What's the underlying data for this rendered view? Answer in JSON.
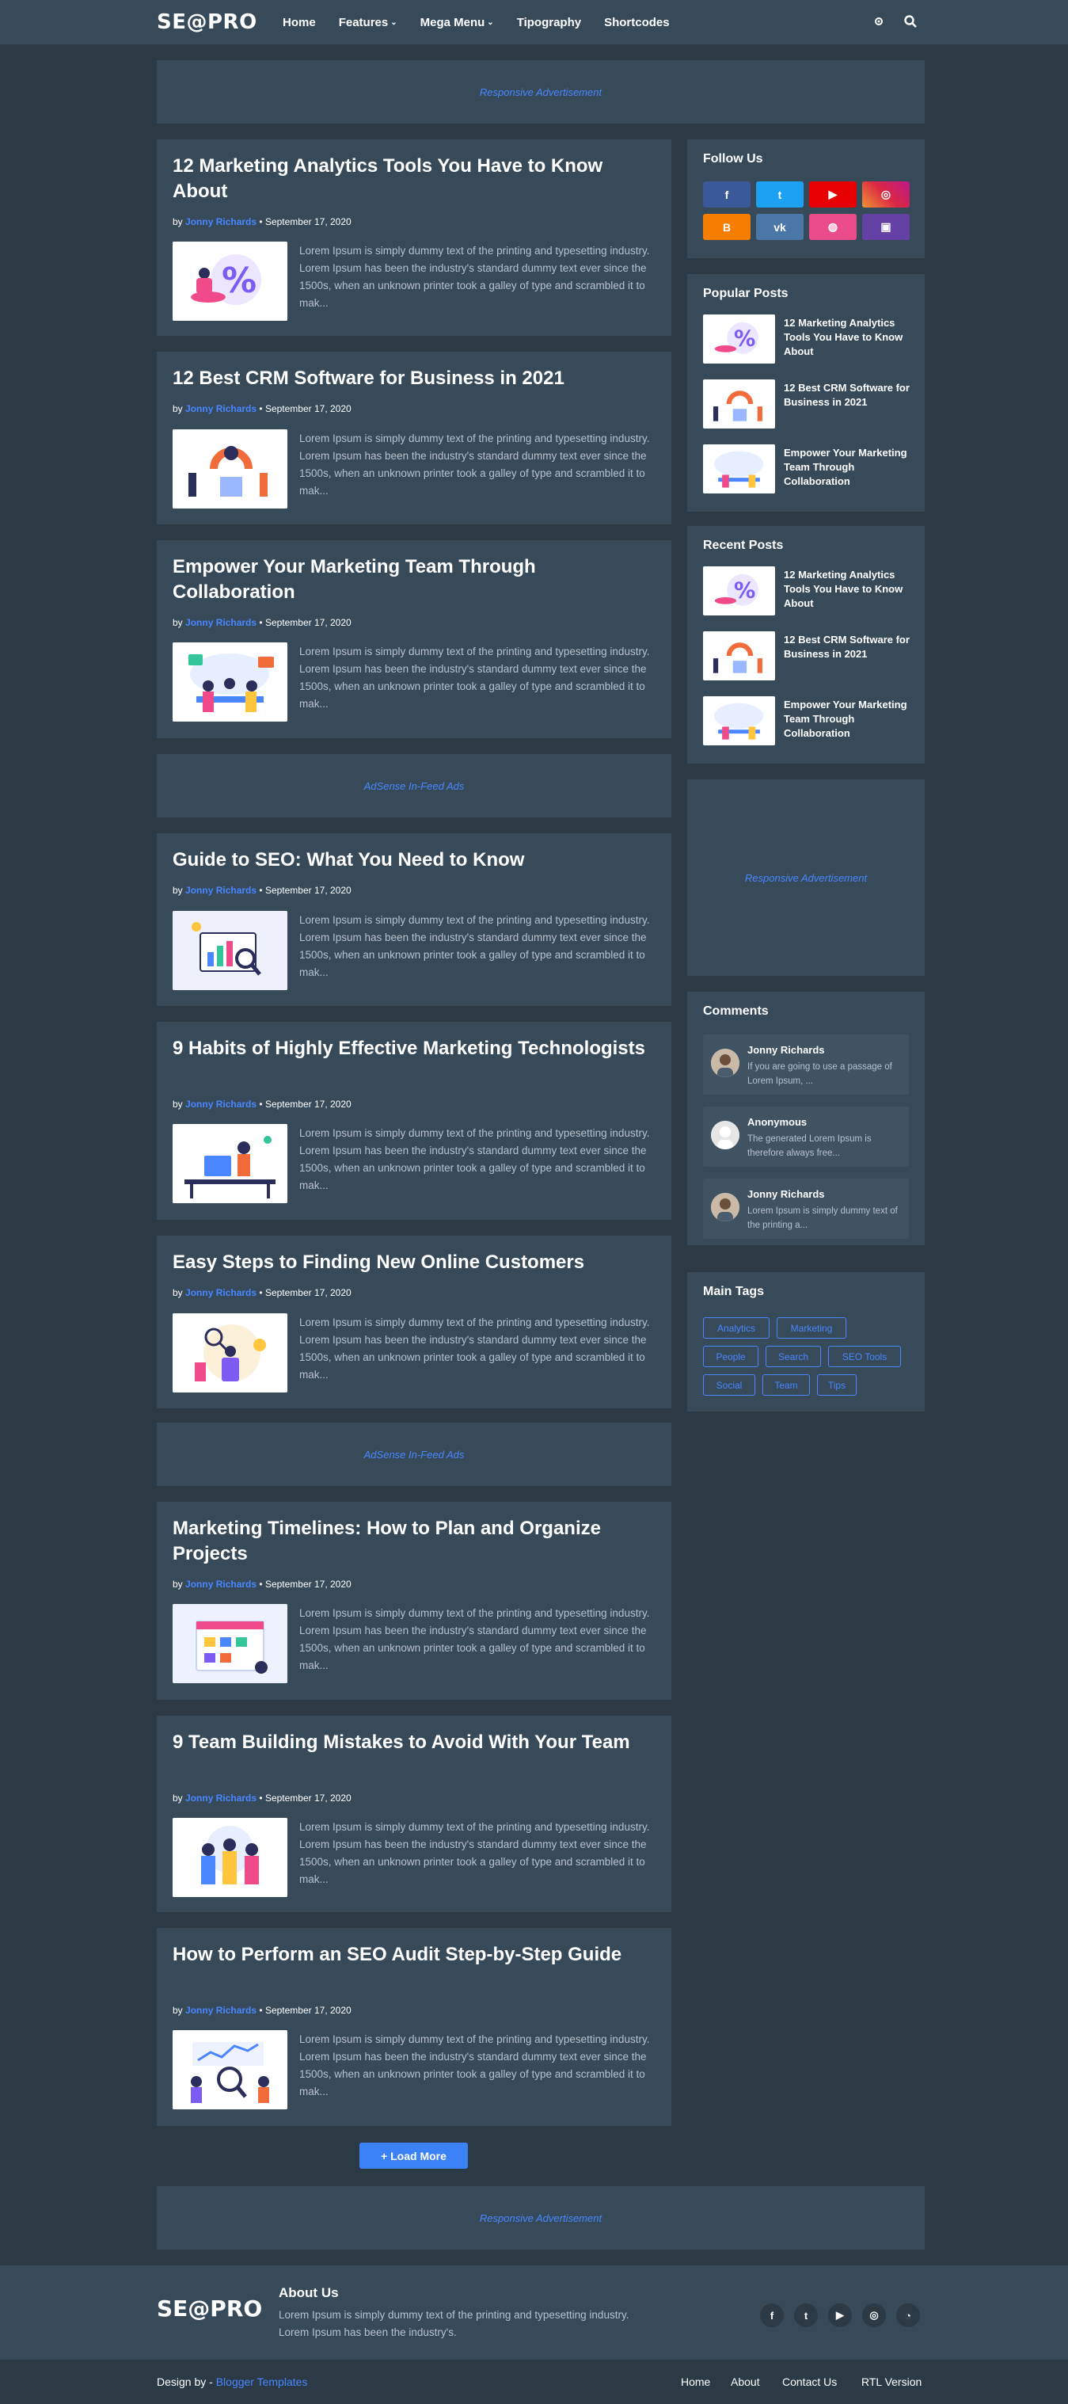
{
  "header": {
    "logo": "SE@PRO",
    "nav": [
      {
        "label": "Home",
        "dropdown": false
      },
      {
        "label": "Features",
        "dropdown": true
      },
      {
        "label": "Mega Menu",
        "dropdown": true
      },
      {
        "label": "Tipography",
        "dropdown": false
      },
      {
        "label": "Shortcodes",
        "dropdown": false
      }
    ],
    "icons": [
      "theme-toggle-icon",
      "search-icon"
    ]
  },
  "ads": {
    "top": "Responsive Advertisement",
    "infeed1": "AdSense In-Feed Ads",
    "infeed2": "AdSense In-Feed Ads",
    "sidebar": "Responsive Advertisement",
    "bottom": "Responsive Advertisement"
  },
  "posts": [
    {
      "title": "12 Marketing Analytics Tools You Have to Know About",
      "by": "by",
      "author": "Jonny Richards",
      "date": "• September 17, 2020",
      "excerpt": "Lorem Ipsum is simply dummy text of the printing and typesetting industry. Lorem Ipsum has been the industry's standard dummy text ever since the 1500s, when an unknown printer took a galley of type and scrambled it to mak..."
    },
    {
      "title": "12 Best CRM Software for Business in 2021",
      "by": "by",
      "author": "Jonny Richards",
      "date": "• September 17, 2020",
      "excerpt": "Lorem Ipsum is simply dummy text of the printing and typesetting industry. Lorem Ipsum has been the industry's standard dummy text ever since the 1500s, when an unknown printer took a galley of type and scrambled it to mak..."
    },
    {
      "title": "Empower Your Marketing Team Through Collaboration",
      "by": "by",
      "author": "Jonny Richards",
      "date": "• September 17, 2020",
      "excerpt": "Lorem Ipsum is simply dummy text of the printing and typesetting industry. Lorem Ipsum has been the industry's standard dummy text ever since the 1500s, when an unknown printer took a galley of type and scrambled it to mak..."
    },
    {
      "title": "Guide to SEO: What You Need to Know",
      "by": "by",
      "author": "Jonny Richards",
      "date": "• September 17, 2020",
      "excerpt": "Lorem Ipsum is simply dummy text of the printing and typesetting industry. Lorem Ipsum has been the industry's standard dummy text ever since the 1500s, when an unknown printer took a galley of type and scrambled it to mak..."
    },
    {
      "title": "9 Habits of Highly Effective Marketing Technologists",
      "by": "by",
      "author": "Jonny Richards",
      "date": "• September 17, 2020",
      "excerpt": "Lorem Ipsum is simply dummy text of the printing and typesetting industry. Lorem Ipsum has been the industry's standard dummy text ever since the 1500s, when an unknown printer took a galley of type and scrambled it to mak..."
    },
    {
      "title": "Easy Steps to Finding New Online Customers",
      "by": "by",
      "author": "Jonny Richards",
      "date": "• September 17, 2020",
      "excerpt": "Lorem Ipsum is simply dummy text of the printing and typesetting industry. Lorem Ipsum has been the industry's standard dummy text ever since the 1500s, when an unknown printer took a galley of type and scrambled it to mak..."
    },
    {
      "title": "Marketing Timelines: How to Plan and Organize Projects",
      "by": "by",
      "author": "Jonny Richards",
      "date": "• September 17, 2020",
      "excerpt": "Lorem Ipsum is simply dummy text of the printing and typesetting industry. Lorem Ipsum has been the industry's standard dummy text ever since the 1500s, when an unknown printer took a galley of type and scrambled it to mak..."
    },
    {
      "title": "9 Team Building Mistakes to Avoid With Your Team",
      "by": "by",
      "author": "Jonny Richards",
      "date": "• September 17, 2020",
      "excerpt": "Lorem Ipsum is simply dummy text of the printing and typesetting industry. Lorem Ipsum has been the industry's standard dummy text ever since the 1500s, when an unknown printer took a galley of type and scrambled it to mak..."
    },
    {
      "title": "How to Perform an SEO Audit Step-by-Step Guide",
      "by": "by",
      "author": "Jonny Richards",
      "date": "• September 17, 2020",
      "excerpt": "Lorem Ipsum is simply dummy text of the printing and typesetting industry. Lorem Ipsum has been the industry's standard dummy text ever since the 1500s, when an unknown printer took a galley of type and scrambled it to mak..."
    }
  ],
  "load_more": "+ Load More",
  "sidebar": {
    "follow_title": "Follow Us",
    "social": [
      {
        "name": "facebook-icon",
        "glyph": "f",
        "color": "#3b5998"
      },
      {
        "name": "twitter-icon",
        "glyph": "t",
        "color": "#1da1f2"
      },
      {
        "name": "youtube-icon",
        "glyph": "▶",
        "color": "#e60000"
      },
      {
        "name": "instagram-icon",
        "glyph": "◎",
        "color": "#c13584"
      },
      {
        "name": "blogger-icon",
        "glyph": "B",
        "color": "#f57d00"
      },
      {
        "name": "vk-icon",
        "glyph": "vk",
        "color": "#4a76a8"
      },
      {
        "name": "dribbble-icon",
        "glyph": "◍",
        "color": "#ea4c89"
      },
      {
        "name": "twitch-icon",
        "glyph": "▣",
        "color": "#6441a5"
      }
    ],
    "popular_title": "Popular Posts",
    "popular": [
      "12 Marketing Analytics Tools You Have to Know About",
      "12 Best CRM Software for Business in 2021",
      "Empower Your Marketing Team Through Collaboration"
    ],
    "recent_title": "Recent Posts",
    "recent": [
      "12 Marketing Analytics Tools You Have to Know About",
      "12 Best CRM Software for Business in 2021",
      "Empower Your Marketing Team Through Collaboration"
    ],
    "comments_title": "Comments",
    "comments": [
      {
        "name": "Jonny Richards",
        "text": "If you are going to use a passage of Lorem Ipsum, ..."
      },
      {
        "name": "Anonymous",
        "text": "The generated Lorem Ipsum is therefore always free..."
      },
      {
        "name": "Jonny Richards",
        "text": "Lorem Ipsum is simply dummy text of the printing a..."
      }
    ],
    "tags_title": "Main Tags",
    "tags": [
      "Analytics",
      "Marketing",
      "People",
      "Search",
      "SEO Tools",
      "Social",
      "Team",
      "Tips"
    ]
  },
  "footer": {
    "logo": "SE@PRO",
    "about_title": "About Us",
    "about_text": "Lorem Ipsum is simply dummy text of the printing and typesetting industry. Lorem Ipsum has been the industry's.",
    "social": [
      {
        "name": "facebook-icon",
        "glyph": "f"
      },
      {
        "name": "twitter-icon",
        "glyph": "t"
      },
      {
        "name": "youtube-icon",
        "glyph": "▶"
      },
      {
        "name": "instagram-icon",
        "glyph": "◎"
      },
      {
        "name": "rss-icon",
        "glyph": "◔"
      }
    ],
    "credit_prefix": "Design by -",
    "credit_link": "Blogger Templates",
    "menu": [
      "Home",
      "About",
      "Contact Us",
      "RTL Version"
    ]
  }
}
